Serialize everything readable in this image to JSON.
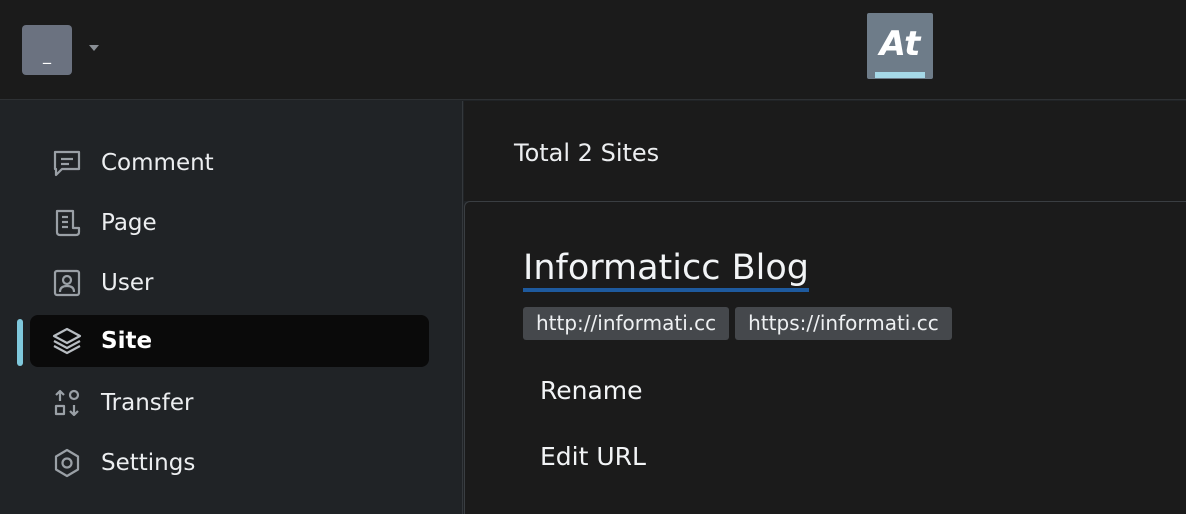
{
  "topbar": {
    "avatar_text": "_",
    "logo_text": "At"
  },
  "sidebar": {
    "items": [
      {
        "label": "Comment",
        "icon": "comment-icon",
        "active": false
      },
      {
        "label": "Page",
        "icon": "page-icon",
        "active": false
      },
      {
        "label": "User",
        "icon": "user-icon",
        "active": false
      },
      {
        "label": "Site",
        "icon": "layers-icon",
        "active": true
      },
      {
        "label": "Transfer",
        "icon": "transfer-icon",
        "active": false
      },
      {
        "label": "Settings",
        "icon": "settings-icon",
        "active": false
      }
    ]
  },
  "main": {
    "title": "Total 2 Sites",
    "site": {
      "name": "Informaticc Blog",
      "urls": [
        "http://informati.cc",
        "https://informati.cc"
      ],
      "actions": [
        "Rename",
        "Edit URL"
      ]
    }
  },
  "colors": {
    "accent": "#7fc8dc",
    "link_underline": "#1e5a9e",
    "background": "#202326",
    "panel": "#1b1b1b"
  }
}
